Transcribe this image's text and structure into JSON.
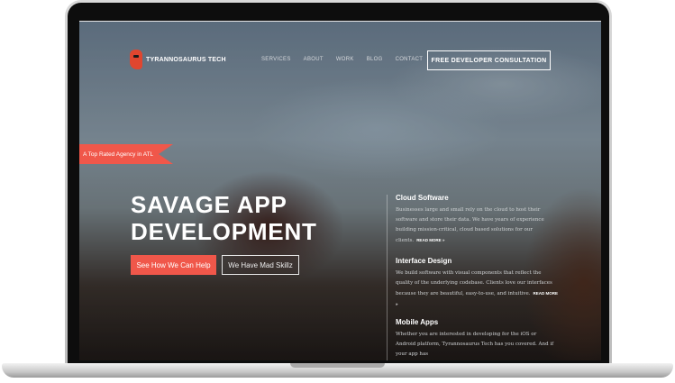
{
  "header": {
    "logo_text": "TYRANNOSAURUS TECH",
    "nav": [
      "SERVICES",
      "ABOUT",
      "WORK",
      "BLOG",
      "CONTACT"
    ],
    "cta_label": "FREE DEVELOPER CONSULTATION"
  },
  "ribbon": "A Top Rated Agency in ATL",
  "hero": {
    "title_line1": "SAVAGE APP",
    "title_line2": "DEVELOPMENT",
    "primary_button": "See How We Can Help",
    "secondary_button": "We Have Mad Skillz"
  },
  "services": [
    {
      "title": "Cloud Software",
      "body": "Businesses large and small rely on the cloud to host their software and store their data. We have years of experience building mission-critical, cloud based solutions for our clients.",
      "more": "READ MORE »"
    },
    {
      "title": "Interface Design",
      "body": "We build software with visual components that reflect the quality of the underlying codebase. Clients love our interfaces because they are beautiful, easy-to-use, and intuitive.",
      "more": "READ MORE »"
    },
    {
      "title": "Mobile Apps",
      "body": "Whether you are interested in developing for the iOS or Android platform, Tyrannosaurus Tech has you covered. And if your app has",
      "more": ""
    }
  ]
}
